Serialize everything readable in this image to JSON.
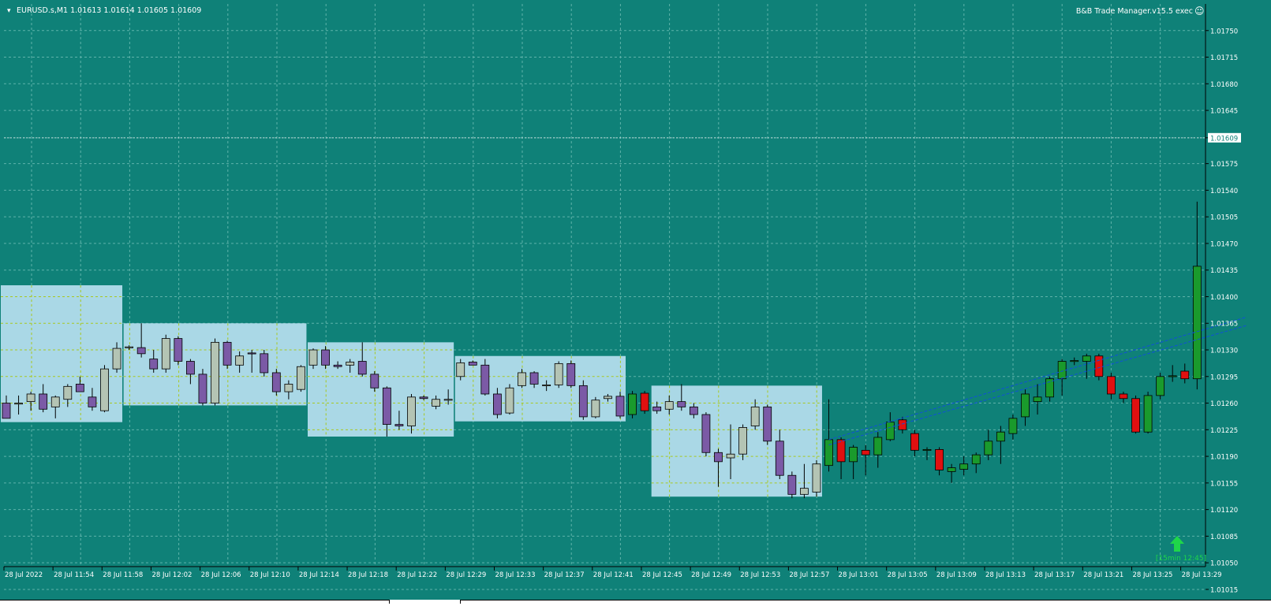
{
  "header": {
    "dropdown_glyph": "▾",
    "symbol_info": "EURUSD.s,M1  1.01613 1.01614 1.01605 1.01609",
    "ea_label": "B&B Trade Manager.v15.5 exec",
    "ea_icon": "☺"
  },
  "signal": {
    "icon": "up-arrow-icon",
    "label": "[15min 12:45]",
    "color": "#1fd64a"
  },
  "colors": {
    "background": "#0f8178",
    "grid": "#5fb3aa",
    "axis": "#000000",
    "label": "#ffffff",
    "bull": "#1a9a2c",
    "bear": "#e01010",
    "bull_session": "#b4c4b4",
    "bear_session": "#7b5aa6",
    "session_box": "#aad8e6",
    "session_grid": "#a8c820",
    "trendline": "#1050d8",
    "price_tag_bg": "#ffffff",
    "price_tag_text": "#0f8178"
  },
  "chart_data": {
    "type": "candlestick",
    "symbol": "EURUSD.s",
    "timeframe": "M1",
    "current_price": "1.01609",
    "ylim": [
      1.01045,
      1.01785
    ],
    "y_ticks": [
      "1.01750",
      "1.01715",
      "1.01680",
      "1.01645",
      "1.01609",
      "1.01575",
      "1.01540",
      "1.01505",
      "1.01470",
      "1.01435",
      "1.01400",
      "1.01365",
      "1.01330",
      "1.01295",
      "1.01260",
      "1.01225",
      "1.01190",
      "1.01155",
      "1.01120",
      "1.01085",
      "1.01050",
      "1.01015"
    ],
    "x_ticks": [
      "28 Jul 2022",
      "28 Jul 11:54",
      "28 Jul 11:58",
      "28 Jul 12:02",
      "28 Jul 12:06",
      "28 Jul 12:10",
      "28 Jul 12:14",
      "28 Jul 12:18",
      "28 Jul 12:22",
      "28 Jul 12:29",
      "28 Jul 12:33",
      "28 Jul 12:37",
      "28 Jul 12:41",
      "28 Jul 12:45",
      "28 Jul 12:49",
      "28 Jul 12:53",
      "28 Jul 12:57",
      "28 Jul 13:01",
      "28 Jul 13:05",
      "28 Jul 13:09",
      "28 Jul 13:13",
      "28 Jul 13:17",
      "28 Jul 13:21",
      "28 Jul 13:25",
      "28 Jul 13:29"
    ],
    "sessions": [
      {
        "high": 1.01415,
        "low": 1.01235
      },
      {
        "high": 1.01365,
        "low": 1.01257
      },
      {
        "high": 1.0134,
        "low": 1.01216
      },
      {
        "high": 1.01322,
        "low": 1.01236
      },
      {
        "high": 1.01283,
        "low": 1.01137
      }
    ],
    "candles": [
      {
        "o": 1.0126,
        "h": 1.0127,
        "l": 1.0124,
        "c": 1.0124,
        "s": 0
      },
      {
        "o": 1.0126,
        "h": 1.0127,
        "l": 1.01245,
        "c": 1.0126,
        "s": 0
      },
      {
        "o": 1.01262,
        "h": 1.01275,
        "l": 1.0125,
        "c": 1.01272,
        "s": 0
      },
      {
        "o": 1.01272,
        "h": 1.01285,
        "l": 1.01248,
        "c": 1.01252,
        "s": 0
      },
      {
        "o": 1.01255,
        "h": 1.0127,
        "l": 1.0124,
        "c": 1.01268,
        "s": 0
      },
      {
        "o": 1.01265,
        "h": 1.01285,
        "l": 1.01255,
        "c": 1.01282,
        "s": 0
      },
      {
        "o": 1.01285,
        "h": 1.01295,
        "l": 1.01275,
        "c": 1.01275,
        "s": 0
      },
      {
        "o": 1.01268,
        "h": 1.0128,
        "l": 1.0125,
        "c": 1.01255,
        "s": 0
      },
      {
        "o": 1.0125,
        "h": 1.0131,
        "l": 1.01248,
        "c": 1.01305,
        "s": 0
      },
      {
        "o": 1.01305,
        "h": 1.0134,
        "l": 1.013,
        "c": 1.01332,
        "s": 0
      },
      {
        "o": 1.01333,
        "h": 1.01336,
        "l": 1.0133,
        "c": 1.01334,
        "s": 1
      },
      {
        "o": 1.01333,
        "h": 1.01365,
        "l": 1.0132,
        "c": 1.01325,
        "s": 1
      },
      {
        "o": 1.01318,
        "h": 1.0133,
        "l": 1.013,
        "c": 1.01305,
        "s": 1
      },
      {
        "o": 1.01305,
        "h": 1.0135,
        "l": 1.013,
        "c": 1.01345,
        "s": 1
      },
      {
        "o": 1.01345,
        "h": 1.01348,
        "l": 1.0131,
        "c": 1.01315,
        "s": 1
      },
      {
        "o": 1.01315,
        "h": 1.01318,
        "l": 1.01285,
        "c": 1.01298,
        "s": 1
      },
      {
        "o": 1.01298,
        "h": 1.01305,
        "l": 1.01257,
        "c": 1.0126,
        "s": 1
      },
      {
        "o": 1.0126,
        "h": 1.01345,
        "l": 1.01257,
        "c": 1.0134,
        "s": 1
      },
      {
        "o": 1.0134,
        "h": 1.01342,
        "l": 1.01305,
        "c": 1.0131,
        "s": 1
      },
      {
        "o": 1.0131,
        "h": 1.01328,
        "l": 1.013,
        "c": 1.01322,
        "s": 1
      },
      {
        "o": 1.01326,
        "h": 1.0133,
        "l": 1.013,
        "c": 1.01325,
        "s": 1
      },
      {
        "o": 1.01325,
        "h": 1.0133,
        "l": 1.01295,
        "c": 1.013,
        "s": 1
      },
      {
        "o": 1.013,
        "h": 1.01305,
        "l": 1.0127,
        "c": 1.01275,
        "s": 1
      },
      {
        "o": 1.01275,
        "h": 1.0129,
        "l": 1.01265,
        "c": 1.01285,
        "s": 1
      },
      {
        "o": 1.01278,
        "h": 1.0131,
        "l": 1.01275,
        "c": 1.01308,
        "s": 1
      },
      {
        "o": 1.0131,
        "h": 1.01332,
        "l": 1.01305,
        "c": 1.0133,
        "s": 2
      },
      {
        "o": 1.0133,
        "h": 1.01335,
        "l": 1.01305,
        "c": 1.0131,
        "s": 2
      },
      {
        "o": 1.0131,
        "h": 1.01315,
        "l": 1.01305,
        "c": 1.01308,
        "s": 2
      },
      {
        "o": 1.0131,
        "h": 1.01318,
        "l": 1.013,
        "c": 1.01314,
        "s": 2
      },
      {
        "o": 1.01315,
        "h": 1.0134,
        "l": 1.01295,
        "c": 1.01298,
        "s": 2
      },
      {
        "o": 1.01298,
        "h": 1.01302,
        "l": 1.01275,
        "c": 1.0128,
        "s": 2
      },
      {
        "o": 1.0128,
        "h": 1.01282,
        "l": 1.01216,
        "c": 1.01232,
        "s": 2
      },
      {
        "o": 1.01232,
        "h": 1.0125,
        "l": 1.01225,
        "c": 1.0123,
        "s": 2
      },
      {
        "o": 1.0123,
        "h": 1.01272,
        "l": 1.0122,
        "c": 1.01268,
        "s": 2
      },
      {
        "o": 1.01268,
        "h": 1.0127,
        "l": 1.01264,
        "c": 1.01266,
        "s": 2
      },
      {
        "o": 1.01256,
        "h": 1.0127,
        "l": 1.01252,
        "c": 1.01265,
        "s": 2
      },
      {
        "o": 1.01265,
        "h": 1.01278,
        "l": 1.01258,
        "c": 1.01265,
        "s": 2
      },
      {
        "o": 1.01295,
        "h": 1.01318,
        "l": 1.0129,
        "c": 1.01313,
        "s": 3
      },
      {
        "o": 1.01314,
        "h": 1.01316,
        "l": 1.0131,
        "c": 1.0131,
        "s": 3
      },
      {
        "o": 1.0131,
        "h": 1.01318,
        "l": 1.0127,
        "c": 1.01272,
        "s": 3
      },
      {
        "o": 1.01272,
        "h": 1.0128,
        "l": 1.0124,
        "c": 1.01245,
        "s": 3
      },
      {
        "o": 1.01247,
        "h": 1.01285,
        "l": 1.01245,
        "c": 1.0128,
        "s": 3
      },
      {
        "o": 1.01283,
        "h": 1.01305,
        "l": 1.0128,
        "c": 1.013,
        "s": 3
      },
      {
        "o": 1.013,
        "h": 1.01302,
        "l": 1.0128,
        "c": 1.01285,
        "s": 3
      },
      {
        "o": 1.01284,
        "h": 1.0129,
        "l": 1.01276,
        "c": 1.01284,
        "s": 3
      },
      {
        "o": 1.01284,
        "h": 1.01315,
        "l": 1.0128,
        "c": 1.01312,
        "s": 3
      },
      {
        "o": 1.01312,
        "h": 1.01316,
        "l": 1.0128,
        "c": 1.01283,
        "s": 3
      },
      {
        "o": 1.01283,
        "h": 1.0129,
        "l": 1.01238,
        "c": 1.01242,
        "s": 3
      },
      {
        "o": 1.01242,
        "h": 1.01268,
        "l": 1.0124,
        "c": 1.01264,
        "s": 3
      },
      {
        "o": 1.01266,
        "h": 1.01272,
        "l": 1.01262,
        "c": 1.01269,
        "s": 3
      },
      {
        "o": 1.01269,
        "h": 1.01275,
        "l": 1.0124,
        "c": 1.01243,
        "s": 3
      },
      {
        "o": 1.01245,
        "h": 1.01276,
        "l": 1.0124,
        "c": 1.01272,
        "s": -1
      },
      {
        "o": 1.01273,
        "h": 1.01276,
        "l": 1.01246,
        "c": 1.0125,
        "s": -1
      },
      {
        "o": 1.01255,
        "h": 1.01262,
        "l": 1.01246,
        "c": 1.0125,
        "s": 4
      },
      {
        "o": 1.01252,
        "h": 1.0127,
        "l": 1.01245,
        "c": 1.01262,
        "s": 4
      },
      {
        "o": 1.01262,
        "h": 1.01285,
        "l": 1.0125,
        "c": 1.01255,
        "s": 4
      },
      {
        "o": 1.01255,
        "h": 1.0126,
        "l": 1.0124,
        "c": 1.01245,
        "s": 4
      },
      {
        "o": 1.01245,
        "h": 1.01248,
        "l": 1.0119,
        "c": 1.01195,
        "s": 4
      },
      {
        "o": 1.01195,
        "h": 1.012,
        "l": 1.0115,
        "c": 1.01183,
        "s": 4
      },
      {
        "o": 1.01188,
        "h": 1.01232,
        "l": 1.0116,
        "c": 1.01193,
        "s": 4
      },
      {
        "o": 1.01193,
        "h": 1.01232,
        "l": 1.01185,
        "c": 1.01228,
        "s": 4
      },
      {
        "o": 1.0123,
        "h": 1.01265,
        "l": 1.01225,
        "c": 1.01255,
        "s": 4
      },
      {
        "o": 1.01255,
        "h": 1.01258,
        "l": 1.01205,
        "c": 1.0121,
        "s": 4
      },
      {
        "o": 1.0121,
        "h": 1.01225,
        "l": 1.0116,
        "c": 1.01165,
        "s": 4
      },
      {
        "o": 1.01165,
        "h": 1.0117,
        "l": 1.01135,
        "c": 1.0114,
        "s": 4
      },
      {
        "o": 1.0114,
        "h": 1.0118,
        "l": 1.01135,
        "c": 1.01148,
        "s": 4
      },
      {
        "o": 1.01143,
        "h": 1.01185,
        "l": 1.01137,
        "c": 1.0118,
        "s": 4
      },
      {
        "o": 1.01178,
        "h": 1.01265,
        "l": 1.0117,
        "c": 1.01212,
        "s": -1
      },
      {
        "o": 1.01212,
        "h": 1.01215,
        "l": 1.0116,
        "c": 1.01183,
        "s": -1
      },
      {
        "o": 1.01183,
        "h": 1.01205,
        "l": 1.0116,
        "c": 1.01202,
        "s": -1
      },
      {
        "o": 1.01198,
        "h": 1.01205,
        "l": 1.01165,
        "c": 1.01192,
        "s": -1
      },
      {
        "o": 1.01192,
        "h": 1.01222,
        "l": 1.01175,
        "c": 1.01215,
        "s": -1
      },
      {
        "o": 1.01212,
        "h": 1.01248,
        "l": 1.0121,
        "c": 1.01235,
        "s": -1
      },
      {
        "o": 1.01238,
        "h": 1.01242,
        "l": 1.0122,
        "c": 1.01225,
        "s": -1
      },
      {
        "o": 1.0122,
        "h": 1.01225,
        "l": 1.0119,
        "c": 1.01198,
        "s": -1
      },
      {
        "o": 1.01198,
        "h": 1.01202,
        "l": 1.01185,
        "c": 1.01199,
        "s": -1
      },
      {
        "o": 1.01199,
        "h": 1.01202,
        "l": 1.01165,
        "c": 1.01172,
        "s": -1
      },
      {
        "o": 1.0117,
        "h": 1.0118,
        "l": 1.01155,
        "c": 1.01175,
        "s": -1
      },
      {
        "o": 1.01173,
        "h": 1.0119,
        "l": 1.01165,
        "c": 1.0118,
        "s": -1
      },
      {
        "o": 1.0118,
        "h": 1.01195,
        "l": 1.01168,
        "c": 1.01192,
        "s": -1
      },
      {
        "o": 1.01192,
        "h": 1.01225,
        "l": 1.01185,
        "c": 1.0121,
        "s": -1
      },
      {
        "o": 1.0121,
        "h": 1.0123,
        "l": 1.0118,
        "c": 1.01222,
        "s": -1
      },
      {
        "o": 1.0122,
        "h": 1.01245,
        "l": 1.01212,
        "c": 1.0124,
        "s": -1
      },
      {
        "o": 1.01242,
        "h": 1.01278,
        "l": 1.0123,
        "c": 1.01272,
        "s": -1
      },
      {
        "o": 1.01262,
        "h": 1.01285,
        "l": 1.01245,
        "c": 1.01268,
        "s": -1
      },
      {
        "o": 1.01268,
        "h": 1.01295,
        "l": 1.01262,
        "c": 1.01292,
        "s": -1
      },
      {
        "o": 1.01292,
        "h": 1.01318,
        "l": 1.0127,
        "c": 1.01315,
        "s": -1
      },
      {
        "o": 1.01315,
        "h": 1.0132,
        "l": 1.0131,
        "c": 1.01316,
        "s": -1
      },
      {
        "o": 1.01315,
        "h": 1.01325,
        "l": 1.01292,
        "c": 1.01322,
        "s": -1
      },
      {
        "o": 1.01322,
        "h": 1.01325,
        "l": 1.0129,
        "c": 1.01295,
        "s": -1
      },
      {
        "o": 1.01295,
        "h": 1.013,
        "l": 1.01265,
        "c": 1.01272,
        "s": -1
      },
      {
        "o": 1.01272,
        "h": 1.01275,
        "l": 1.0126,
        "c": 1.01266,
        "s": -1
      },
      {
        "o": 1.01266,
        "h": 1.0127,
        "l": 1.0122,
        "c": 1.01222,
        "s": -1
      },
      {
        "o": 1.01222,
        "h": 1.01275,
        "l": 1.0122,
        "c": 1.0127,
        "s": -1
      },
      {
        "o": 1.0127,
        "h": 1.013,
        "l": 1.01265,
        "c": 1.01295,
        "s": -1
      },
      {
        "o": 1.01296,
        "h": 1.0131,
        "l": 1.01288,
        "c": 1.01296,
        "s": -1
      },
      {
        "o": 1.01302,
        "h": 1.01312,
        "l": 1.01286,
        "c": 1.01292,
        "s": -1
      },
      {
        "o": 1.01292,
        "h": 1.01525,
        "l": 1.01278,
        "c": 1.0144,
        "s": -1
      }
    ],
    "trendlines": [
      {
        "from_candle": 67,
        "from_price": 1.01212,
        "to_candle": 101,
        "to_price": 1.01373
      },
      {
        "from_candle": 67,
        "from_price": 1.01205,
        "to_candle": 101,
        "to_price": 1.01362
      }
    ]
  }
}
